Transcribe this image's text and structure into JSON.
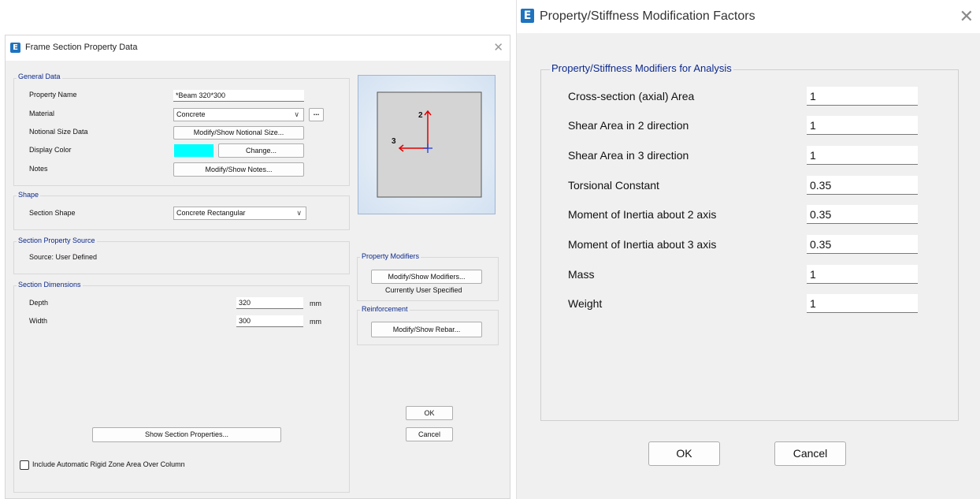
{
  "frame_dialog": {
    "title": "Frame Section Property Data",
    "general_data": {
      "group_label": "General Data",
      "property_name_label": "Property Name",
      "property_name_value": "*Beam 320*300",
      "material_label": "Material",
      "material_value": "Concrete",
      "material_more": "...",
      "notional_label": "Notional Size Data",
      "notional_button": "Modify/Show Notional Size...",
      "display_color_label": "Display Color",
      "display_color_swatch": "#00ffff",
      "change_button": "Change...",
      "notes_label": "Notes",
      "notes_button": "Modify/Show Notes..."
    },
    "shape": {
      "group_label": "Shape",
      "section_shape_label": "Section Shape",
      "section_shape_value": "Concrete Rectangular"
    },
    "source": {
      "group_label": "Section Property Source",
      "text": "Source:  User Defined"
    },
    "dimensions": {
      "group_label": "Section Dimensions",
      "depth_label": "Depth",
      "depth_value": "320",
      "depth_unit": "mm",
      "width_label": "Width",
      "width_value": "300",
      "width_unit": "mm"
    },
    "preview": {
      "axis2_label": "2",
      "axis3_label": "3"
    },
    "property_modifiers": {
      "group_label": "Property Modifiers",
      "button": "Modify/Show Modifiers...",
      "status": "Currently User Specified"
    },
    "reinforcement": {
      "group_label": "Reinforcement",
      "button": "Modify/Show Rebar..."
    },
    "ok_label": "OK",
    "cancel_label": "Cancel",
    "show_properties_button": "Show Section Properties...",
    "rigid_zone_checkbox_label": "Include Automatic Rigid Zone Area Over Column",
    "rigid_zone_checked": false
  },
  "modifier_dialog": {
    "title": "Property/Stiffness Modification Factors",
    "group_label": "Property/Stiffness Modifiers for Analysis",
    "rows": [
      {
        "label": "Cross-section (axial) Area",
        "value": "1"
      },
      {
        "label": "Shear Area in 2 direction",
        "value": "1"
      },
      {
        "label": "Shear Area in 3 direction",
        "value": "1"
      },
      {
        "label": "Torsional Constant",
        "value": "0.35"
      },
      {
        "label": "Moment of Inertia about 2 axis",
        "value": "0.35"
      },
      {
        "label": "Moment of Inertia about 3 axis",
        "value": "0.35"
      },
      {
        "label": "Mass",
        "value": "1"
      },
      {
        "label": "Weight",
        "value": "1"
      }
    ],
    "ok_label": "OK",
    "cancel_label": "Cancel"
  },
  "logo_letter": "E",
  "close_glyph": "✕"
}
